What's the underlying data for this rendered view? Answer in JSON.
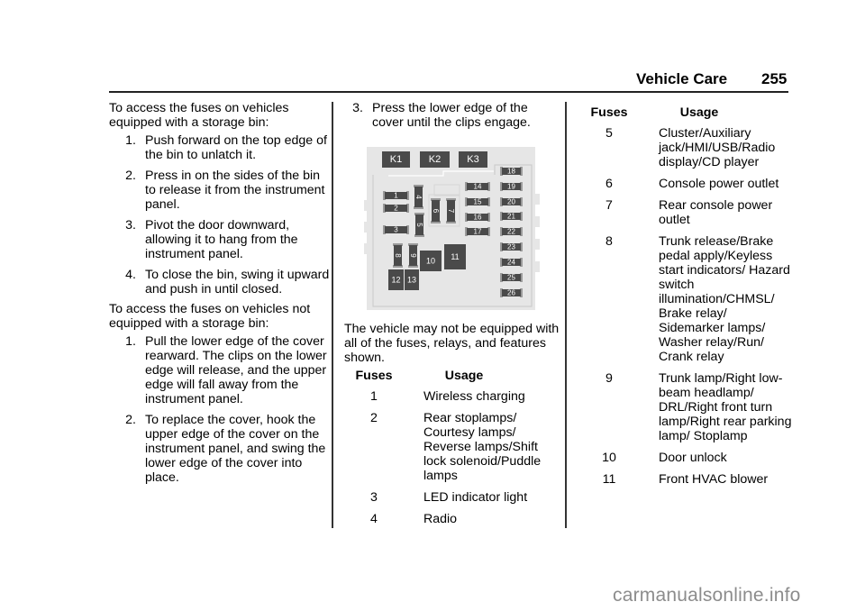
{
  "header": {
    "section_title": "Vehicle Care",
    "page_number": "255"
  },
  "column1": {
    "intro_storage_bin": "To access the fuses on vehicles equipped with a storage bin:",
    "storage_bin_steps": [
      {
        "num": "1.",
        "text": "Push forward on the top edge of the bin to unlatch it."
      },
      {
        "num": "2.",
        "text": "Press in on the sides of the bin to release it from the instrument panel."
      },
      {
        "num": "3.",
        "text": "Pivot the door downward, allowing it to hang from the instrument panel."
      },
      {
        "num": "4.",
        "text": "To close the bin, swing it upward and push in until closed."
      }
    ],
    "intro_no_storage_bin": "To access the fuses on vehicles not equipped with a storage bin:",
    "no_storage_bin_steps": [
      {
        "num": "1.",
        "text": "Pull the lower edge of the cover rearward. The clips on the lower edge will release, and the upper edge will fall away from the instrument panel."
      },
      {
        "num": "2.",
        "text": "To replace the cover, hook the upper edge of the cover on the instrument panel, and swing the lower edge of the cover into place."
      }
    ]
  },
  "column2": {
    "step3": {
      "num": "3.",
      "text": "Press the lower edge of the cover until the clips engage."
    },
    "diagram": {
      "relays": [
        "K1",
        "K2",
        "K3"
      ],
      "fuse_labels": [
        "1",
        "2",
        "3",
        "4",
        "5",
        "6",
        "7",
        "8",
        "9",
        "10",
        "11",
        "12",
        "13",
        "14",
        "15",
        "16",
        "17",
        "18",
        "19",
        "20",
        "21",
        "22",
        "23",
        "24",
        "25",
        "26"
      ],
      "colors": {
        "panel": "#e6e6e6",
        "outline": "#c8c8c8",
        "component": "#4a4a4a",
        "label": "#ffffff"
      }
    },
    "note": "The vehicle may not be equipped with all of the fuses, relays, and features shown.",
    "table_headers": {
      "fuses": "Fuses",
      "usage": "Usage"
    },
    "rows": [
      {
        "fuse": "1",
        "usage": "Wireless charging"
      },
      {
        "fuse": "2",
        "usage": "Rear stoplamps/ Courtesy lamps/ Reverse lamps/Shift lock solenoid/Puddle lamps"
      },
      {
        "fuse": "3",
        "usage": "LED indicator light"
      },
      {
        "fuse": "4",
        "usage": "Radio"
      }
    ]
  },
  "column3": {
    "table_headers": {
      "fuses": "Fuses",
      "usage": "Usage"
    },
    "rows": [
      {
        "fuse": "5",
        "usage": "Cluster/Auxiliary jack/HMI/USB/Radio display/CD player"
      },
      {
        "fuse": "6",
        "usage": "Console power outlet"
      },
      {
        "fuse": "7",
        "usage": "Rear console power outlet"
      },
      {
        "fuse": "8",
        "usage": "Trunk release/Brake pedal apply/Keyless start indicators/ Hazard switch illumination/CHMSL/ Brake relay/ Sidemarker lamps/ Washer relay/Run/ Crank relay"
      },
      {
        "fuse": "9",
        "usage": "Trunk lamp/Right low-beam headlamp/ DRL/Right front turn lamp/Right rear parking lamp/ Stoplamp"
      },
      {
        "fuse": "10",
        "usage": "Door unlock"
      },
      {
        "fuse": "11",
        "usage": "Front HVAC blower"
      }
    ]
  },
  "watermark": "carmanualsonline.info"
}
